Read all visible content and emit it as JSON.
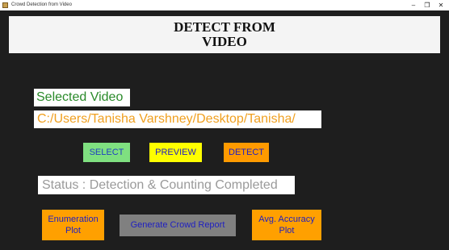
{
  "window": {
    "title": "Crowd Detection from Video",
    "controls": {
      "minimize": "–",
      "maximize": "❐",
      "close": "✕"
    }
  },
  "header": {
    "title": "DETECT  FROM\nVIDEO"
  },
  "selected_video": {
    "label": "Selected Video",
    "path": "C:/Users/Tanisha Varshney/Desktop/Tanisha/"
  },
  "buttons": {
    "select": "SELECT",
    "preview": "PREVIEW",
    "detect": "DETECT",
    "enumeration_plot": "Enumeration\nPlot",
    "crowd_report": "Generate  Crowd  Report",
    "accuracy_plot": "Avg. Accuracy\nPlot"
  },
  "status": {
    "text": "Status : Detection & Counting Completed"
  },
  "colors": {
    "background": "#1e1e1e",
    "select_bg": "#7fe080",
    "preview_bg": "#ffff00",
    "detect_bg": "#ff9a00",
    "report_bg": "#808080",
    "plot_bg": "#ffa000"
  }
}
